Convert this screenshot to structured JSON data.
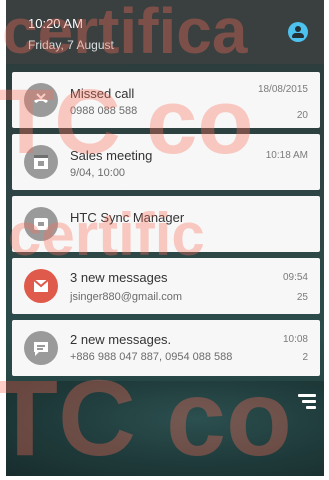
{
  "status": {
    "time": "10:20 AM",
    "date": "Friday, 7 August"
  },
  "notifications": [
    {
      "title": "Missed call",
      "subtitle": "0988 088 588",
      "time": "18/08/2015",
      "count": "20",
      "icon": "missed-call-icon"
    },
    {
      "title": "Sales meeting",
      "subtitle": "9/04, 10:00",
      "time": "10:18 AM",
      "count": "",
      "icon": "calendar-icon"
    },
    {
      "title": "HTC Sync Manager",
      "subtitle": "",
      "time": "",
      "count": "",
      "icon": "sync-icon"
    },
    {
      "title": "3 new messages",
      "subtitle": "jsinger880@gmail.com",
      "time": "09:54",
      "count": "25",
      "icon": "mail-icon",
      "accent": "#e05a4b"
    },
    {
      "title": "2 new messages.",
      "subtitle": "+886 988 047 887, 0954 088 588",
      "time": "10:08",
      "count": "2",
      "icon": "message-icon"
    }
  ],
  "watermark": {
    "line1": "certifica",
    "line2": "TC co",
    "line3": "certific",
    "line4": "TC co"
  },
  "colors": {
    "accent": "#4ec2ee",
    "mail": "#e05a4b"
  }
}
